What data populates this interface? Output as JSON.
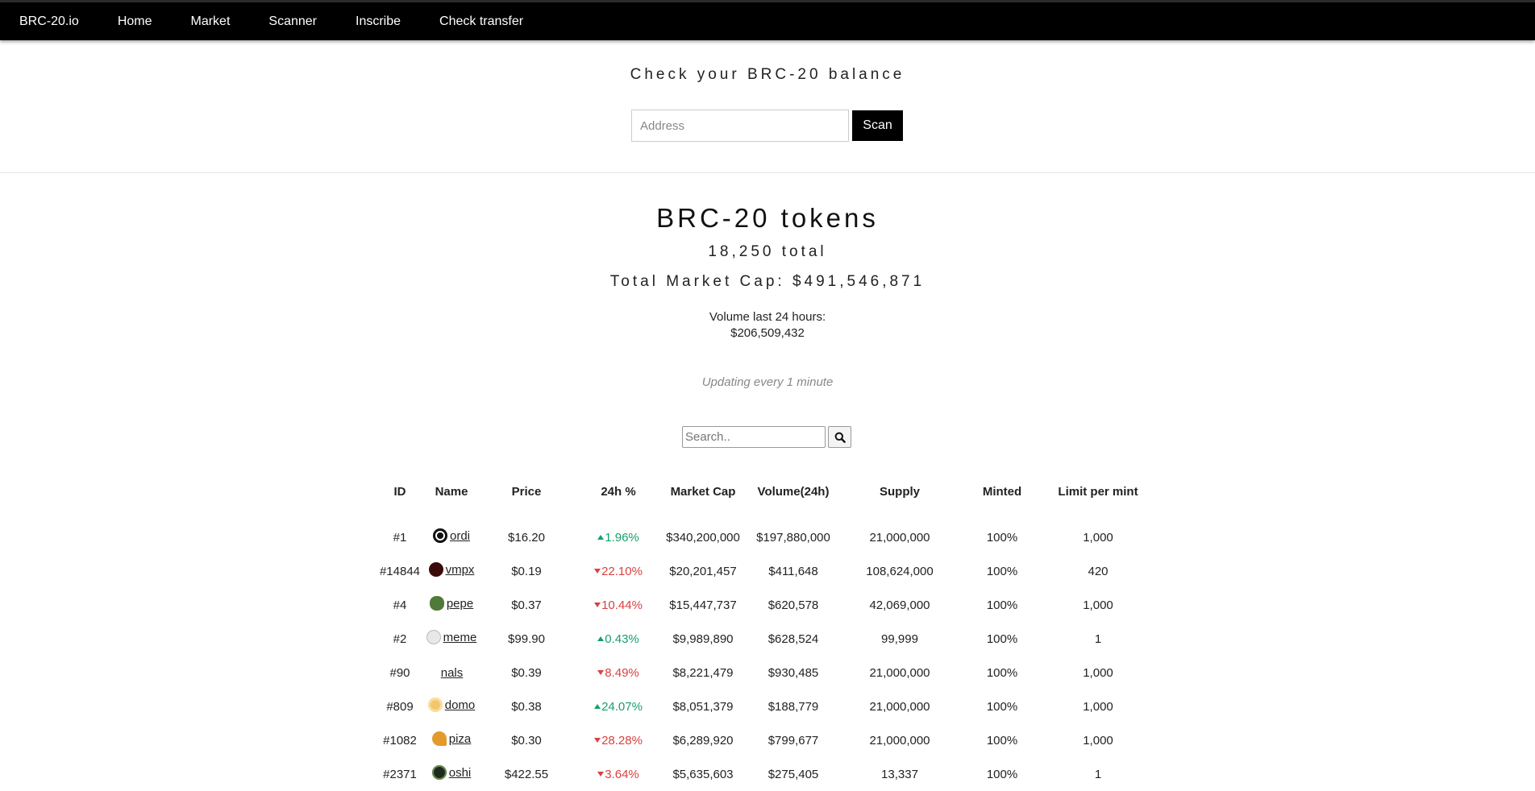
{
  "nav": {
    "brand": "BRC-20.io",
    "items": [
      "Home",
      "Market",
      "Scanner",
      "Inscribe",
      "Check transfer"
    ]
  },
  "balance": {
    "title": "Check your BRC-20 balance",
    "address_placeholder": "Address",
    "scan_label": "Scan"
  },
  "tokens": {
    "title": "BRC-20 tokens",
    "total": "18,250 total",
    "market_cap": "Total Market Cap: $491,546,871",
    "volume_label": "Volume last 24 hours:",
    "volume_value": "$206,509,432",
    "updating": "Updating every 1 minute",
    "search_placeholder": "Search.."
  },
  "table": {
    "headers": [
      "ID",
      "Name",
      "Price",
      "24h %",
      "Market Cap",
      "Volume(24h)",
      "Supply",
      "Minted",
      "Limit per mint"
    ],
    "rows": [
      {
        "id": "#1",
        "name": "ordi",
        "icon": "ordi-logo-icon",
        "price": "$16.20",
        "change": "1.96%",
        "dir": "up",
        "mcap": "$340,200,000",
        "volume": "$197,880,000",
        "supply": "21,000,000",
        "minted": "100%",
        "limit": "1,000"
      },
      {
        "id": "#14844",
        "name": "vmpx",
        "icon": "vmpx-logo-icon",
        "price": "$0.19",
        "change": "22.10%",
        "dir": "down",
        "mcap": "$20,201,457",
        "volume": "$411,648",
        "supply": "108,624,000",
        "minted": "100%",
        "limit": "420"
      },
      {
        "id": "#4",
        "name": "pepe",
        "icon": "pepe-frog-icon",
        "price": "$0.37",
        "change": "10.44%",
        "dir": "down",
        "mcap": "$15,447,737",
        "volume": "$620,578",
        "supply": "42,069,000",
        "minted": "100%",
        "limit": "1,000"
      },
      {
        "id": "#2",
        "name": "meme",
        "icon": "meme-face-icon",
        "price": "$99.90",
        "change": "0.43%",
        "dir": "up",
        "mcap": "$9,989,890",
        "volume": "$628,524",
        "supply": "99,999",
        "minted": "100%",
        "limit": "1"
      },
      {
        "id": "#90",
        "name": "nals",
        "icon": "",
        "price": "$0.39",
        "change": "8.49%",
        "dir": "down",
        "mcap": "$8,221,479",
        "volume": "$930,485",
        "supply": "21,000,000",
        "minted": "100%",
        "limit": "1,000"
      },
      {
        "id": "#809",
        "name": "domo",
        "icon": "domo-coin-icon",
        "price": "$0.38",
        "change": "24.07%",
        "dir": "up",
        "mcap": "$8,051,379",
        "volume": "$188,779",
        "supply": "21,000,000",
        "minted": "100%",
        "limit": "1,000"
      },
      {
        "id": "#1082",
        "name": "piza",
        "icon": "pizza-slice-icon",
        "price": "$0.30",
        "change": "28.28%",
        "dir": "down",
        "mcap": "$6,289,920",
        "volume": "$799,677",
        "supply": "21,000,000",
        "minted": "100%",
        "limit": "1,000"
      },
      {
        "id": "#2371",
        "name": "oshi",
        "icon": "oshi-logo-icon",
        "price": "$422.55",
        "change": "3.64%",
        "dir": "down",
        "mcap": "$5,635,603",
        "volume": "$275,405",
        "supply": "13,337",
        "minted": "100%",
        "limit": "1"
      }
    ]
  },
  "colors": {
    "up": "#16a06a",
    "down": "#d94040",
    "nav_bg": "#000000"
  }
}
